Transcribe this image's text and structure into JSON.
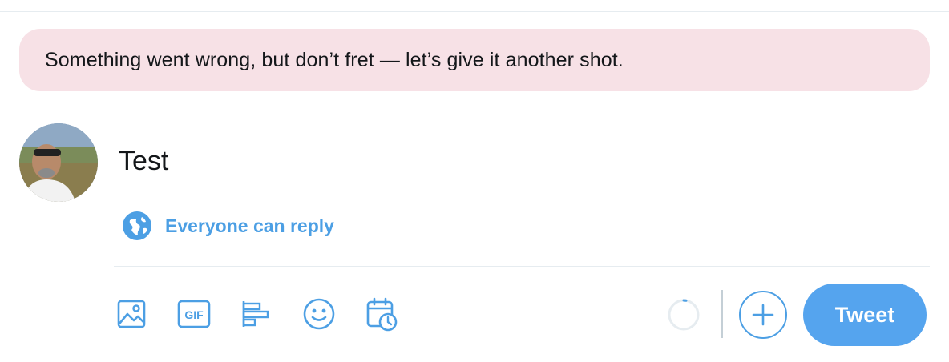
{
  "error": {
    "message": "Something went wrong, but don’t fret — let’s give it another shot."
  },
  "composer": {
    "text": "Test",
    "reply_setting": "Everyone can reply",
    "tweet_button": "Tweet",
    "toolbar": {
      "icons": [
        "media-icon",
        "gif-icon",
        "poll-icon",
        "emoji-icon",
        "schedule-icon"
      ],
      "gif_label": "GIF"
    }
  },
  "colors": {
    "accent": "#4c9fe4",
    "tweet_button_bg": "#55a4ee",
    "error_bg": "#f7e1e6",
    "text": "#14171a"
  }
}
